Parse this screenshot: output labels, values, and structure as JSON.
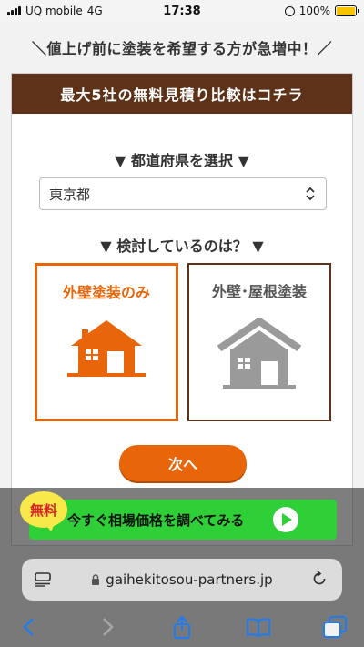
{
  "status_bar": {
    "carrier": "UQ mobile",
    "network": "4G",
    "time": "17:38",
    "battery": "100%"
  },
  "headline": "＼値上げ前に塗装を希望する方が急増中！／",
  "card": {
    "header": "最大5社の無料見積り比較はコチラ",
    "prefecture_label": "▼ 都道府県を選択 ▼",
    "prefecture_value": "東京都",
    "consider_label": "▼ 検討しているのは？ ▼",
    "options": [
      {
        "label": "外壁塗装のみ",
        "selected": true
      },
      {
        "label": "外壁･屋根塗装",
        "selected": false
      }
    ],
    "next_button": "次へ"
  },
  "cta": {
    "badge": "無料",
    "text": "今すぐ相場価格を調べてみる"
  },
  "browser": {
    "url": "gaihekitosou-partners.jp"
  },
  "colors": {
    "brown": "#5e3218",
    "orange": "#e8650a",
    "green": "#2fcf37",
    "ios_blue": "#1f7cf0"
  },
  "icons": [
    "signal-icon",
    "lock-rotation-icon",
    "battery-icon",
    "house-icon",
    "play-icon",
    "reader-icon",
    "lock-icon",
    "reload-icon",
    "back-icon",
    "forward-icon",
    "share-icon",
    "bookmarks-icon",
    "tabs-icon"
  ]
}
